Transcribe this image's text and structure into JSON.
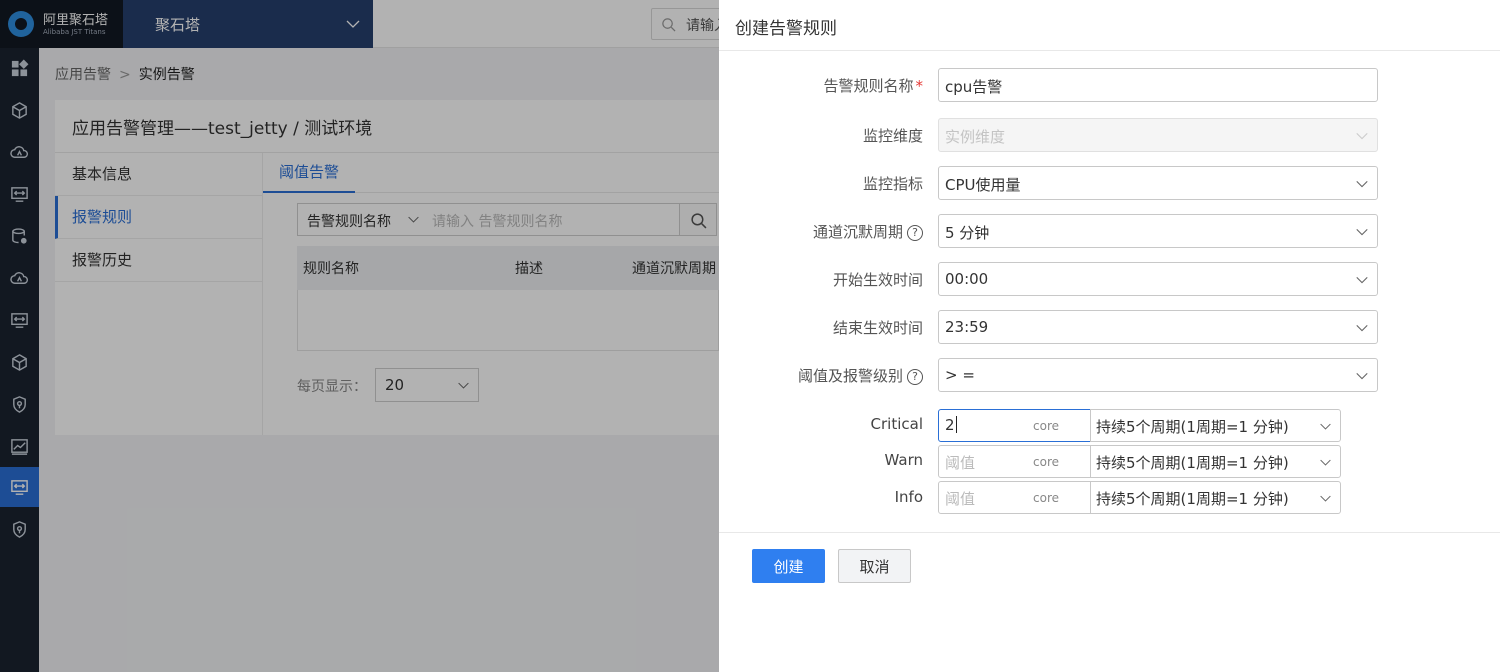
{
  "topbar": {
    "brand_cn": "阿里聚石塔",
    "brand_en": "Alibaba JST Titans",
    "product": "聚石塔",
    "search_placeholder": "请输入"
  },
  "breadcrumb": {
    "parent": "应用告警",
    "separator": ">",
    "current": "实例告警"
  },
  "card": {
    "title": "应用告警管理——test_jetty / 测试环境"
  },
  "subnav": {
    "items": [
      "基本信息",
      "报警规则",
      "报警历史"
    ],
    "active_index": 1
  },
  "tabs": [
    {
      "label": "阈值告警"
    }
  ],
  "filter": {
    "field_label": "告警规则名称",
    "placeholder": "请输入 告警规则名称"
  },
  "table": {
    "columns": [
      "规则名称",
      "描述",
      "通道沉默周期"
    ]
  },
  "pager": {
    "label": "每页显示：",
    "page_size": "20"
  },
  "drawer": {
    "title": "创建告警规则",
    "fields": {
      "rule_name": {
        "label": "告警规则名称",
        "required_mark": "*",
        "value": "cpu告警"
      },
      "dimension": {
        "label": "监控维度",
        "value": "实例维度"
      },
      "metric": {
        "label": "监控指标",
        "value": "CPU使用量"
      },
      "silence": {
        "label": "通道沉默周期",
        "help": "?",
        "value": "5 分钟"
      },
      "start_time": {
        "label": "开始生效时间",
        "value": "00:00"
      },
      "end_time": {
        "label": "结束生效时间",
        "value": "23:59"
      },
      "threshold": {
        "label": "阈值及报警级别",
        "help": "?",
        "value": "> ="
      }
    },
    "levels": [
      {
        "label": "Critical",
        "value": "2",
        "placeholder": "",
        "unit": "core",
        "duration": "持续5个周期(1周期=1 分钟)"
      },
      {
        "label": "Warn",
        "value": "",
        "placeholder": "阈值",
        "unit": "core",
        "duration": "持续5个周期(1周期=1 分钟)"
      },
      {
        "label": "Info",
        "value": "",
        "placeholder": "阈值",
        "unit": "core",
        "duration": "持续5个周期(1周期=1 分钟)"
      }
    ],
    "buttons": {
      "create": "创建",
      "cancel": "取消"
    }
  },
  "colors": {
    "primary": "#2f7ff0",
    "rail_bg": "#1b2330",
    "product_bg": "#26406e",
    "required": "#e53935"
  },
  "icons": [
    "dashboard-icon",
    "cube-icon",
    "cloud-icon",
    "monitor-icon",
    "database-icon",
    "cloud-icon",
    "monitor-icon",
    "cube-icon",
    "shield-icon",
    "chart-icon",
    "monitor-icon",
    "shield-icon"
  ]
}
